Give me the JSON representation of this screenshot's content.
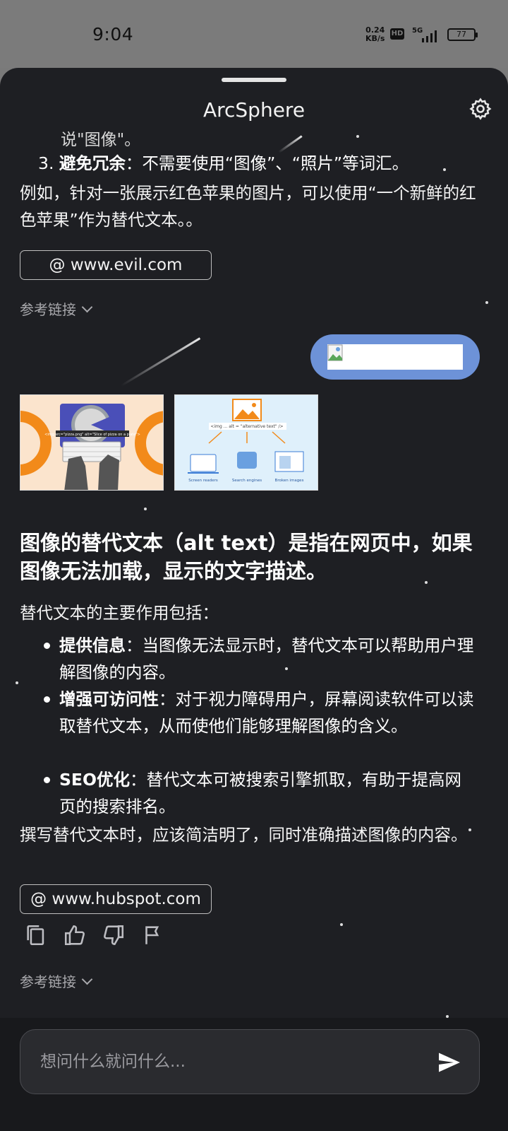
{
  "status_bar": {
    "time": "9:04",
    "net_speed_value": "0.24",
    "net_speed_unit": "KB/s",
    "hd_badge": "HD",
    "network": "5G",
    "battery": "77"
  },
  "header": {
    "title": "ArcSphere",
    "settings_icon": "gear-icon"
  },
  "message1": {
    "cut_text": "说\"图像\"。",
    "item3_number": "3.",
    "item3_bold": "避免冗余",
    "item3_text": "：不需要使用“图像”、“照片”等词汇。",
    "example_text": "例如，针对一张展示红色苹果的图片，可以使用“一个新鲜的红色苹果”作为替代文本。。",
    "source_chip": "@ www.evil.com",
    "references_label": "参考链接"
  },
  "user_message": {
    "image_alt": "broken image"
  },
  "message2": {
    "heading": "图像的替代文本（alt text）是指在网页中，如果图像无法加载，显示的文字描述。",
    "intro": "替代文本的主要作用包括：",
    "bullets": [
      {
        "bold": "提供信息",
        "text": "：当图像无法显示时，替代文本可以帮助用户理解图像的内容。"
      },
      {
        "bold": "增强可访问性",
        "text": "：对于视力障碍用户，屏幕阅读软件可以读取替代文本，从而使他们能够理解图像的含义。"
      },
      {
        "bold": "SEO优化",
        "text": "：替代文本可被搜索引擎抓取，有助于提高网页的搜索排名。"
      }
    ],
    "closing": "撰写替代文本时，应该简洁明了，同时准确描述图像的内容。",
    "source_chip": "@ www.hubspot.com",
    "references_label": "参考链接"
  },
  "thumb2": {
    "code_text": "<img  ...  alt = \"alternative text\"  />",
    "labels": [
      "Screen readers",
      "Search engines",
      "Broken images"
    ]
  },
  "thumb1": {
    "code_text": "<img src=\"pizza.png\" alt=\"Slice of pizza on a plate\">"
  },
  "actions": [
    "copy-icon",
    "thumbs-up-icon",
    "thumbs-down-icon",
    "flag-icon"
  ],
  "input": {
    "placeholder": "想问什么就问什么..."
  },
  "colors": {
    "sheet_bg": "#1e1f23",
    "user_bubble": "#6d92d8",
    "status_bg": "#7b7b7b"
  }
}
